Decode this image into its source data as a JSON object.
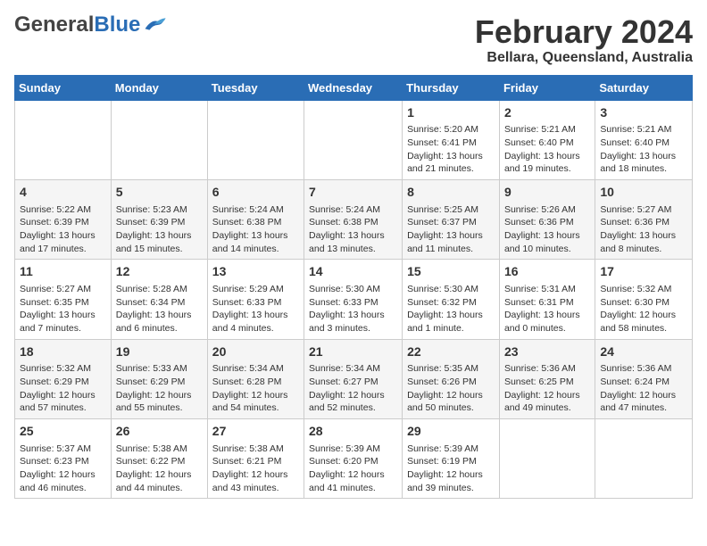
{
  "header": {
    "logo_general": "General",
    "logo_blue": "Blue",
    "month_title": "February 2024",
    "location": "Bellara, Queensland, Australia"
  },
  "weekdays": [
    "Sunday",
    "Monday",
    "Tuesday",
    "Wednesday",
    "Thursday",
    "Friday",
    "Saturday"
  ],
  "weeks": [
    [
      {
        "day": "",
        "info": ""
      },
      {
        "day": "",
        "info": ""
      },
      {
        "day": "",
        "info": ""
      },
      {
        "day": "",
        "info": ""
      },
      {
        "day": "1",
        "info": "Sunrise: 5:20 AM\nSunset: 6:41 PM\nDaylight: 13 hours\nand 21 minutes."
      },
      {
        "day": "2",
        "info": "Sunrise: 5:21 AM\nSunset: 6:40 PM\nDaylight: 13 hours\nand 19 minutes."
      },
      {
        "day": "3",
        "info": "Sunrise: 5:21 AM\nSunset: 6:40 PM\nDaylight: 13 hours\nand 18 minutes."
      }
    ],
    [
      {
        "day": "4",
        "info": "Sunrise: 5:22 AM\nSunset: 6:39 PM\nDaylight: 13 hours\nand 17 minutes."
      },
      {
        "day": "5",
        "info": "Sunrise: 5:23 AM\nSunset: 6:39 PM\nDaylight: 13 hours\nand 15 minutes."
      },
      {
        "day": "6",
        "info": "Sunrise: 5:24 AM\nSunset: 6:38 PM\nDaylight: 13 hours\nand 14 minutes."
      },
      {
        "day": "7",
        "info": "Sunrise: 5:24 AM\nSunset: 6:38 PM\nDaylight: 13 hours\nand 13 minutes."
      },
      {
        "day": "8",
        "info": "Sunrise: 5:25 AM\nSunset: 6:37 PM\nDaylight: 13 hours\nand 11 minutes."
      },
      {
        "day": "9",
        "info": "Sunrise: 5:26 AM\nSunset: 6:36 PM\nDaylight: 13 hours\nand 10 minutes."
      },
      {
        "day": "10",
        "info": "Sunrise: 5:27 AM\nSunset: 6:36 PM\nDaylight: 13 hours\nand 8 minutes."
      }
    ],
    [
      {
        "day": "11",
        "info": "Sunrise: 5:27 AM\nSunset: 6:35 PM\nDaylight: 13 hours\nand 7 minutes."
      },
      {
        "day": "12",
        "info": "Sunrise: 5:28 AM\nSunset: 6:34 PM\nDaylight: 13 hours\nand 6 minutes."
      },
      {
        "day": "13",
        "info": "Sunrise: 5:29 AM\nSunset: 6:33 PM\nDaylight: 13 hours\nand 4 minutes."
      },
      {
        "day": "14",
        "info": "Sunrise: 5:30 AM\nSunset: 6:33 PM\nDaylight: 13 hours\nand 3 minutes."
      },
      {
        "day": "15",
        "info": "Sunrise: 5:30 AM\nSunset: 6:32 PM\nDaylight: 13 hours\nand 1 minute."
      },
      {
        "day": "16",
        "info": "Sunrise: 5:31 AM\nSunset: 6:31 PM\nDaylight: 13 hours\nand 0 minutes."
      },
      {
        "day": "17",
        "info": "Sunrise: 5:32 AM\nSunset: 6:30 PM\nDaylight: 12 hours\nand 58 minutes."
      }
    ],
    [
      {
        "day": "18",
        "info": "Sunrise: 5:32 AM\nSunset: 6:29 PM\nDaylight: 12 hours\nand 57 minutes."
      },
      {
        "day": "19",
        "info": "Sunrise: 5:33 AM\nSunset: 6:29 PM\nDaylight: 12 hours\nand 55 minutes."
      },
      {
        "day": "20",
        "info": "Sunrise: 5:34 AM\nSunset: 6:28 PM\nDaylight: 12 hours\nand 54 minutes."
      },
      {
        "day": "21",
        "info": "Sunrise: 5:34 AM\nSunset: 6:27 PM\nDaylight: 12 hours\nand 52 minutes."
      },
      {
        "day": "22",
        "info": "Sunrise: 5:35 AM\nSunset: 6:26 PM\nDaylight: 12 hours\nand 50 minutes."
      },
      {
        "day": "23",
        "info": "Sunrise: 5:36 AM\nSunset: 6:25 PM\nDaylight: 12 hours\nand 49 minutes."
      },
      {
        "day": "24",
        "info": "Sunrise: 5:36 AM\nSunset: 6:24 PM\nDaylight: 12 hours\nand 47 minutes."
      }
    ],
    [
      {
        "day": "25",
        "info": "Sunrise: 5:37 AM\nSunset: 6:23 PM\nDaylight: 12 hours\nand 46 minutes."
      },
      {
        "day": "26",
        "info": "Sunrise: 5:38 AM\nSunset: 6:22 PM\nDaylight: 12 hours\nand 44 minutes."
      },
      {
        "day": "27",
        "info": "Sunrise: 5:38 AM\nSunset: 6:21 PM\nDaylight: 12 hours\nand 43 minutes."
      },
      {
        "day": "28",
        "info": "Sunrise: 5:39 AM\nSunset: 6:20 PM\nDaylight: 12 hours\nand 41 minutes."
      },
      {
        "day": "29",
        "info": "Sunrise: 5:39 AM\nSunset: 6:19 PM\nDaylight: 12 hours\nand 39 minutes."
      },
      {
        "day": "",
        "info": ""
      },
      {
        "day": "",
        "info": ""
      }
    ]
  ]
}
